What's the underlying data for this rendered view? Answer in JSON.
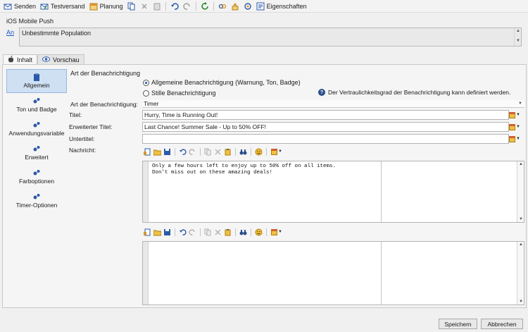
{
  "toolbar": {
    "send": "Senden",
    "test_send": "Testversand",
    "planning": "Planung",
    "properties": "Eigenschaften"
  },
  "header": {
    "push_title": "iOS Mobile Push",
    "pop_link": "An",
    "pop_value": "Unbestimmte Population"
  },
  "tabs": [
    {
      "label": "Inhalt",
      "icon": "apple-icon"
    },
    {
      "label": "Vorschau",
      "icon": "eye-icon"
    }
  ],
  "sidebar": {
    "items": [
      {
        "label": "Allgemein",
        "icon": "clipboard-icon",
        "active": true
      },
      {
        "label": "Ton und Badge",
        "icon": "gear-icon"
      },
      {
        "label": "Anwendungsvariable",
        "icon": "gear-icon"
      },
      {
        "label": "Erweitert",
        "icon": "gear-icon"
      },
      {
        "label": "Farboptionen",
        "icon": "gear-icon"
      },
      {
        "label": "Timer-Optionen",
        "icon": "gear-icon"
      }
    ]
  },
  "content": {
    "section_label": "Art der Benachrichtigung",
    "radio_general": "Allgemeine Benachrichtigung (Warnung, Ton, Badge)",
    "radio_silent": "Stille Benachrichtigung",
    "radio_selected": "general",
    "info_text": "Der Vertraulichkeitsgrad der Benachrichtigung kann definiert werden.",
    "type_label": "Art der Benachrichtigung:",
    "type_value": "Timer",
    "title_label": "Titel:",
    "title_value": "Hurry, Time is Running Out!",
    "ext_title_label": "Erweiterter Titel:",
    "ext_title_value": "Last Chance! Summer Sale - Up to 50% OFF!",
    "subtitle_label": "Untertitel:",
    "subtitle_value": "",
    "message_label": "Nachricht:",
    "message_text": "Only a few hours left to enjoy up to 50% off on all items.\nDon't miss out on these amazing deals!"
  },
  "footer": {
    "save": "Speichern",
    "cancel": "Abbrechen"
  },
  "colors": {
    "accent": "#1a56c8",
    "active_bg": "#cfe0f3",
    "active_border": "#95b6de"
  }
}
